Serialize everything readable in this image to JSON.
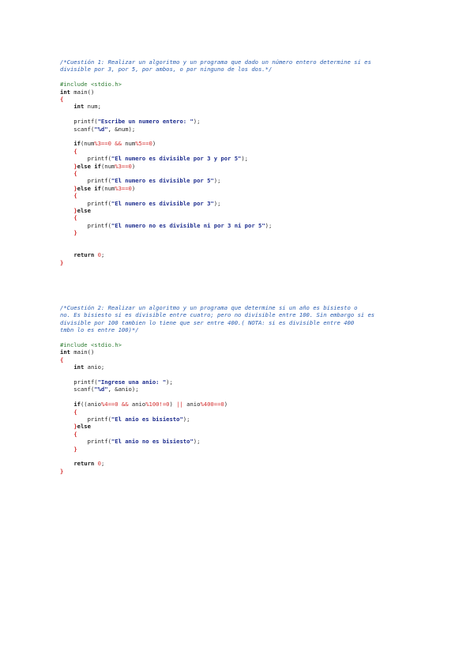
{
  "colors": {
    "comment": "#2a5db0",
    "keyword": "#1a1a1a",
    "string": "#1f2f8f",
    "preprocessor": "#2e7d32",
    "brace": "#d32f2f",
    "operator": "#d32f2f",
    "text": "#222222",
    "background": "#ffffff"
  },
  "blocks": [
    {
      "id": "question-1",
      "lines": [
        [
          [
            "comment",
            "/*Cuestión 1: Realizar un algoritmo y un programa que dado un número entero determine si es"
          ]
        ],
        [
          [
            "comment",
            "divisible por 3, por 5, por ambos, o por ninguno de los dos.*/"
          ]
        ],
        [],
        [
          [
            "preproc",
            "#include <stdio.h>"
          ]
        ],
        [
          [
            "keyword",
            "int"
          ],
          [
            "text",
            " main()"
          ]
        ],
        [
          [
            "brace",
            "{"
          ]
        ],
        [
          [
            "text",
            "    "
          ],
          [
            "keyword",
            "int"
          ],
          [
            "text",
            " num;"
          ]
        ],
        [],
        [
          [
            "text",
            "    printf("
          ],
          [
            "string",
            "\"Escribe un numero entero: \""
          ],
          [
            "text",
            ");"
          ]
        ],
        [
          [
            "text",
            "    scanf("
          ],
          [
            "string",
            "\"%d\""
          ],
          [
            "text",
            ", &num);"
          ]
        ],
        [],
        [
          [
            "text",
            "    "
          ],
          [
            "keyword",
            "if"
          ],
          [
            "text",
            "(num"
          ],
          [
            "op",
            "%3==0 && "
          ],
          [
            "text",
            "num"
          ],
          [
            "op",
            "%5==0"
          ],
          [
            "text",
            ")"
          ]
        ],
        [
          [
            "text",
            "    "
          ],
          [
            "brace",
            "{"
          ]
        ],
        [
          [
            "text",
            "        printf("
          ],
          [
            "string",
            "\"El numero es divisible por 3 y por 5\""
          ],
          [
            "text",
            ");"
          ]
        ],
        [
          [
            "text",
            "    "
          ],
          [
            "brace",
            "}"
          ],
          [
            "keyword",
            "else if"
          ],
          [
            "text",
            "(num"
          ],
          [
            "op",
            "%3==0"
          ],
          [
            "text",
            ")"
          ]
        ],
        [
          [
            "text",
            "    "
          ],
          [
            "brace",
            "{"
          ]
        ],
        [
          [
            "text",
            "        printf("
          ],
          [
            "string",
            "\"El numero es divisible por 5\""
          ],
          [
            "text",
            ");"
          ]
        ],
        [
          [
            "text",
            "    "
          ],
          [
            "brace",
            "}"
          ],
          [
            "keyword",
            "else if"
          ],
          [
            "text",
            "(num"
          ],
          [
            "op",
            "%3==0"
          ],
          [
            "text",
            ")"
          ]
        ],
        [
          [
            "text",
            "    "
          ],
          [
            "brace",
            "{"
          ]
        ],
        [
          [
            "text",
            "        printf("
          ],
          [
            "string",
            "\"El numero es divisible por 3\""
          ],
          [
            "text",
            ");"
          ]
        ],
        [
          [
            "text",
            "    "
          ],
          [
            "brace",
            "}"
          ],
          [
            "keyword",
            "else"
          ]
        ],
        [
          [
            "text",
            "    "
          ],
          [
            "brace",
            "{"
          ]
        ],
        [
          [
            "text",
            "        printf("
          ],
          [
            "string",
            "\"El numero no es divisible ni por 3 ni por 5\""
          ],
          [
            "text",
            ");"
          ]
        ],
        [
          [
            "text",
            "    "
          ],
          [
            "brace",
            "}"
          ]
        ],
        [],
        [],
        [
          [
            "text",
            "    "
          ],
          [
            "keyword",
            "return"
          ],
          [
            "text",
            " "
          ],
          [
            "number",
            "0"
          ],
          [
            "text",
            ";"
          ]
        ],
        [
          [
            "brace",
            "}"
          ]
        ]
      ]
    },
    {
      "id": "question-2",
      "lines": [
        [
          [
            "comment",
            "/*Cuestión 2: Realizar un algoritmo y un programa que determine si un año es bisiesto o"
          ]
        ],
        [
          [
            "comment",
            "no. Es bisiesto si es divisible entre cuatro; pero no divisible entre 100. Sin embargo si es"
          ]
        ],
        [
          [
            "comment",
            "divisible por 100 tambien lo tiene que ser entre 400.( NOTA: si es divisible entre 400"
          ]
        ],
        [
          [
            "comment",
            "tmbn lo es entre 100)*/"
          ]
        ],
        [],
        [
          [
            "preproc",
            "#include <stdio.h>"
          ]
        ],
        [
          [
            "keyword",
            "int"
          ],
          [
            "text",
            " main()"
          ]
        ],
        [
          [
            "brace",
            "{"
          ]
        ],
        [
          [
            "text",
            "    "
          ],
          [
            "keyword",
            "int"
          ],
          [
            "text",
            " anio;"
          ]
        ],
        [],
        [
          [
            "text",
            "    printf("
          ],
          [
            "string",
            "\"Ingrese una anio: \""
          ],
          [
            "text",
            ");"
          ]
        ],
        [
          [
            "text",
            "    scanf("
          ],
          [
            "string",
            "\"%d\""
          ],
          [
            "text",
            ", &anio);"
          ]
        ],
        [],
        [
          [
            "text",
            "    "
          ],
          [
            "keyword",
            "if"
          ],
          [
            "text",
            "((anio"
          ],
          [
            "op",
            "%4==0 && "
          ],
          [
            "text",
            "anio"
          ],
          [
            "op",
            "%100!=0"
          ],
          [
            "text",
            ") "
          ],
          [
            "op",
            "||"
          ],
          [
            "text",
            " anio"
          ],
          [
            "op",
            "%400==0"
          ],
          [
            "text",
            ")"
          ]
        ],
        [
          [
            "text",
            "    "
          ],
          [
            "brace",
            "{"
          ]
        ],
        [
          [
            "text",
            "        printf("
          ],
          [
            "string",
            "\"El anio es bisiesto\""
          ],
          [
            "text",
            ");"
          ]
        ],
        [
          [
            "text",
            "    "
          ],
          [
            "brace",
            "}"
          ],
          [
            "keyword",
            "else"
          ]
        ],
        [
          [
            "text",
            "    "
          ],
          [
            "brace",
            "{"
          ]
        ],
        [
          [
            "text",
            "        printf("
          ],
          [
            "string",
            "\"El anio no es bisiesto\""
          ],
          [
            "text",
            ");"
          ]
        ],
        [
          [
            "text",
            "    "
          ],
          [
            "brace",
            "}"
          ]
        ],
        [],
        [
          [
            "text",
            "    "
          ],
          [
            "keyword",
            "return"
          ],
          [
            "text",
            " "
          ],
          [
            "number",
            "0"
          ],
          [
            "text",
            ";"
          ]
        ],
        [
          [
            "brace",
            "}"
          ]
        ]
      ]
    }
  ]
}
